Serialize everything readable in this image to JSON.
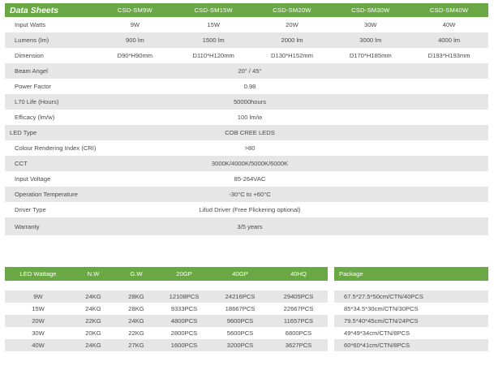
{
  "datasheet": {
    "title": "Data Sheets",
    "models": [
      "CSD-SM9W",
      "CSD-SM15W",
      "CSD-SM20W",
      "CSD-SM30W",
      "CSD-SM40W"
    ],
    "per_model_rows": [
      {
        "label": "Input Watts",
        "values": [
          "9W",
          "15W",
          "20W",
          "30W",
          "40W"
        ]
      },
      {
        "label": "Lumens (lm)",
        "values": [
          "900 lm",
          "1500 lm",
          "2000 lm",
          "3000 lm",
          "4000 lm"
        ]
      },
      {
        "label": "Dimension",
        "values": [
          "D90*H90mm",
          "D110*H120mm",
          "D130*H152mm",
          "D170*H185mm",
          "D193*H193mm"
        ]
      }
    ],
    "shared_rows": [
      {
        "label": "Beam Angel",
        "value": "20° / 45°"
      },
      {
        "label": "Power Factor",
        "value": "0.98"
      },
      {
        "label": "L70 Life (Hours)",
        "value": "50000hours"
      },
      {
        "label": "Efficacy (lm/w)",
        "value": "100 lm/w"
      },
      {
        "label": "LED Type",
        "value": "COB CREE LEDS"
      },
      {
        "label": "Colour Rendering Index (CRI)",
        "value": ">80"
      },
      {
        "label": "CCT",
        "value": "3000K/4000K/5000K/6000K"
      },
      {
        "label": "Input Voltage",
        "value": "85-264VAC"
      },
      {
        "label": "Operation Temperature",
        "value": "-30°C to +60°C"
      },
      {
        "label": "Driver Type",
        "value": "Lifud Driver (Free Flickering optional)"
      },
      {
        "label": "Warranty",
        "value": "3/5 years"
      }
    ]
  },
  "packing": {
    "headers": [
      "LED Wattage",
      "N.W",
      "G.W",
      "20GP",
      "40GP",
      "40HQ"
    ],
    "package_header": "Package",
    "rows": [
      {
        "cells": [
          "9W",
          "24KG",
          "28KG",
          "12108PCS",
          "24216PCS",
          "29405PCS"
        ],
        "package": "67.5*27.5*50cm/CTN/40PCS"
      },
      {
        "cells": [
          "15W",
          "24KG",
          "28KG",
          "9333PCS",
          "18667PCS",
          "22667PCS"
        ],
        "package": "85*34.5*30cm/CTN/30PCS"
      },
      {
        "cells": [
          "20W",
          "22KG",
          "24KG",
          "4800PCS",
          "9600PCS",
          "11657PCS"
        ],
        "package": "79.5*40*45cm/CTN/24PCS"
      },
      {
        "cells": [
          "30W",
          "20KG",
          "22KG",
          "2800PCS",
          "5600PCS",
          "6800PCS"
        ],
        "package": "49*49*34cm/CTN/8PCS"
      },
      {
        "cells": [
          "40W",
          "24KG",
          "27KG",
          "1600PCS",
          "3200PCS",
          "3627PCS"
        ],
        "package": "60*60*41cm/CTN/8PCS"
      }
    ]
  },
  "colors": {
    "accent": "#6aa845",
    "stripe": "#e6e6e6"
  }
}
